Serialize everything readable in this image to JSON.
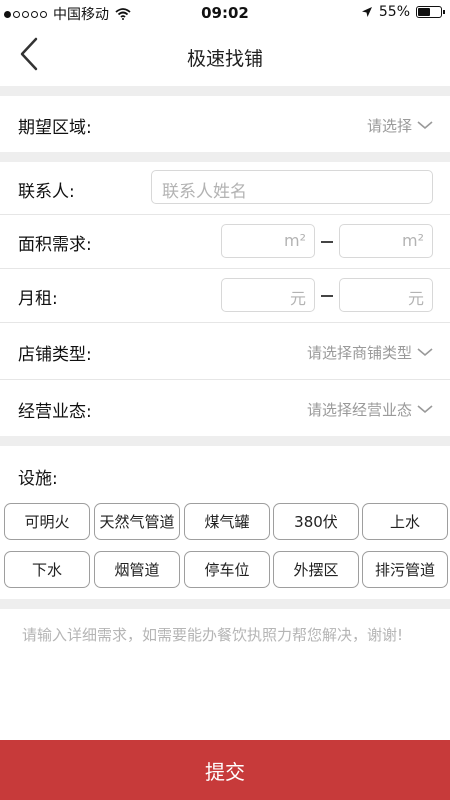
{
  "status_bar": {
    "carrier": "中国移动",
    "time": "09:02",
    "battery": "55%",
    "battery_level": 0.55,
    "signal_dots_filled": 1,
    "signal_dots_total": 5
  },
  "nav": {
    "title": "极速找铺",
    "back_icon": "chevron-left-icon"
  },
  "form": {
    "area": {
      "label": "期望区域:",
      "value": "请选择"
    },
    "contact": {
      "label": "联系人:",
      "placeholder": "联系人姓名"
    },
    "size": {
      "label": "面积需求:",
      "unit": "m²",
      "dash": "–"
    },
    "rent": {
      "label": "月租:",
      "unit": "元",
      "dash": "–"
    },
    "shop_type": {
      "label": "店铺类型:",
      "value": "请选择商铺类型"
    },
    "business": {
      "label": "经营业态:",
      "value": "请选择经营业态"
    }
  },
  "facilities": {
    "label": "设施:",
    "items": [
      "可明火",
      "天然气管道",
      "煤气罐",
      "380伏",
      "上水",
      "下水",
      "烟管道",
      "停车位",
      "外摆区",
      "排污管道"
    ]
  },
  "note": "请输入详细需求，如需要能办餐饮执照力帮您解决，谢谢!",
  "submit": "提交",
  "colors": {
    "accent": "#c73a3a",
    "placeholder": "#b3b3b3",
    "section_gap": "#eeeeee"
  }
}
